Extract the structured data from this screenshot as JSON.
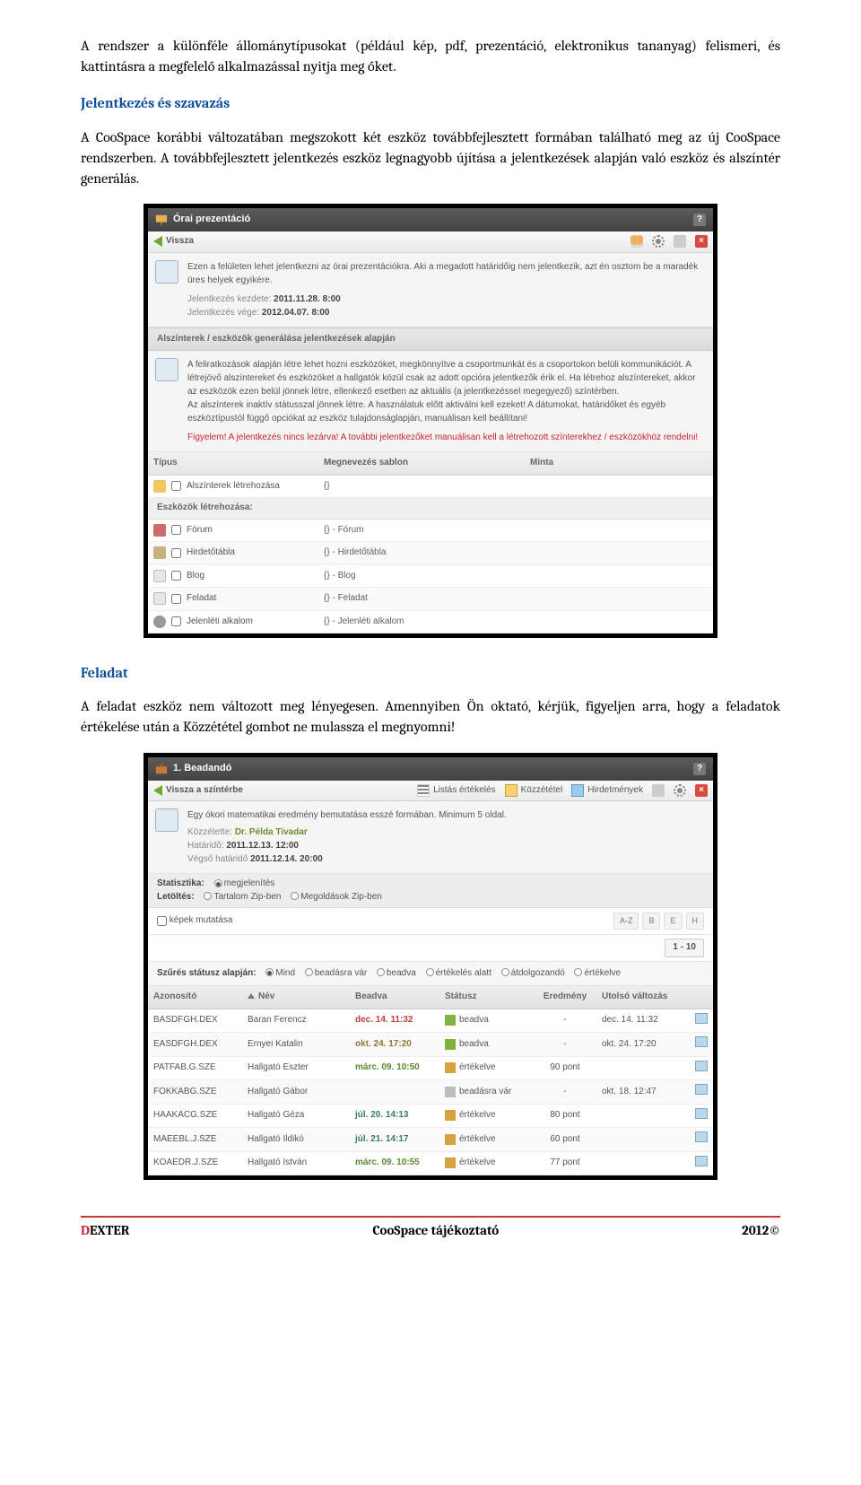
{
  "intro_p": "A rendszer a különféle állománytípusokat (például kép, pdf, prezentáció, elektronikus tananyag) felismeri, és kattintásra a megfelelő alkalmazással nyitja meg őket.",
  "heading_signup": "Jelentkezés és szavazás",
  "signup_p": "A CooSpace korábbi változatában megszokott két eszköz továbbfejlesztett formában található meg az új CooSpace rendszerben. A továbbfejlesztett jelentkezés eszköz legnagyobb újítása a jelentkezések alapján való eszköz és alszíntér generálás.",
  "heading_task": "Feladat",
  "task_p": "A feladat eszköz nem változott meg lényegesen. Amennyiben Ön oktató, kérjük, figyeljen arra, hogy a feladatok értékelése után a Közzététel gombot ne mulassza el megnyomni!",
  "sc1": {
    "title": "Órai prezentáció",
    "back": "Vissza",
    "info_text": "Ezen a felületen lehet jelentkezni az órai prezentációkra. Aki a megadott határidőig nem jelentkezik, azt én osztom be a maradék üres helyek egyikére.",
    "start_label": "Jelentkezés kezdete:",
    "start_value": "2011.11.28. 8:00",
    "end_label": "Jelentkezés vége:",
    "end_value": "2012.04.07. 8:00",
    "gen_title": "Alszínterek / eszközök generálása jelentkezések alapján",
    "gen_info": "A feliratkozások alapján létre lehet hozni eszközöket, megkönnyítve a csoportmunkát és a csoportokon belüli kommunikációt. A létrejövő alszíntereket és eszközöket a hallgatók közül csak az adott opcióra jelentkezők érik el. Ha létrehoz alszíntereket, akkor az eszközök ezen belül jönnek létre, ellenkező esetben az aktuális (a jelentkezéssel megegyező) színtérben.\nAz alszínterek inaktív státusszal jönnek létre. A használatuk előtt aktiválni kell ezeket! A dátumokat, határidőket és egyéb eszköztípustól függő opciókat az eszköz tulajdonságlapján, manuálisan kell beállítani!",
    "gen_warn": "Figyelem! A jelentkezés nincs lezárva! A további jelentkezőket manuálisan kell a létrehozott színterekhez / eszközökhöz rendelni!",
    "col_type": "Típus",
    "col_tpl": "Megnevezés sablon",
    "col_sample": "Minta",
    "row_sub": "Alszínterek létrehozása",
    "tpl_brace": "{}",
    "sub_tools": "Eszközök létrehozása:",
    "rows": [
      {
        "label": "Fórum",
        "tpl": "{} - Fórum"
      },
      {
        "label": "Hirdetőtábla",
        "tpl": "{} - Hirdetőtábla"
      },
      {
        "label": "Blog",
        "tpl": "{} - Blog"
      },
      {
        "label": "Feladat",
        "tpl": "{} - Feladat"
      },
      {
        "label": "Jelenléti alkalom",
        "tpl": "{} - Jelenléti alkalom"
      }
    ]
  },
  "sc2": {
    "title": "1. Beadandó",
    "back": "Vissza a színtérbe",
    "tb_list": "Listás értékelés",
    "tb_pub": "Közzététel",
    "tb_ann": "Hirdetmények",
    "desc": "Egy ókori matematikai eredmény bemutatása esszé formában. Minimum 5 oldal.",
    "by_label": "Közzétette:",
    "by_name": "Dr. Példa Tivadar",
    "dl1_label": "Határidő:",
    "dl1_value": "2011.12.13. 12:00",
    "dl2_label": "Végső határidő",
    "dl2_value": "2011.12.14. 20:00",
    "stat_label": "Statisztika:",
    "stat_show": "megjelenítés",
    "down_label": "Letöltés:",
    "down_o1": "Tartalom Zip-ben",
    "down_o2": "Megoldások Zip-ben",
    "show_images": "képek mutatása",
    "az": "A-Z",
    "b": "B",
    "e": "E",
    "h": "H",
    "pager": "1 - 10",
    "filter_label": "Szűrés státusz alapján:",
    "filter_opts": [
      "Mind",
      "beadásra vár",
      "beadva",
      "értékelés alatt",
      "átdolgozandó",
      "értékelve"
    ],
    "cols": {
      "id": "Azonosító",
      "name": "Név",
      "sub": "Beadva",
      "status": "Státusz",
      "res": "Eredmény",
      "mod": "Utolsó változás"
    },
    "rows": [
      {
        "id": "BASDFGH.DEX",
        "name": "Baran Ferencz",
        "sub": "dec. 14. 11:32",
        "subcls": "date-red",
        "st": "beadva",
        "stcls": "st-green",
        "res": "-",
        "mod": "dec. 14. 11:32"
      },
      {
        "id": "EASDFGH.DEX",
        "name": "Ernyei Katalin",
        "sub": "okt. 24. 17:20",
        "subcls": "date-olive",
        "st": "beadva",
        "stcls": "st-green",
        "res": "-",
        "mod": "okt. 24. 17:20"
      },
      {
        "id": "PATFAB.G.SZE",
        "name": "Hallgató Eszter",
        "sub": "márc. 09. 10:50",
        "subcls": "date-green",
        "st": "értékelve",
        "stcls": "st-amber",
        "res": "90 pont",
        "mod": ""
      },
      {
        "id": "FOKKABG.SZE",
        "name": "Hallgató Gábor",
        "sub": "",
        "subcls": "",
        "st": "beadásra vár",
        "stcls": "st-gray",
        "res": "-",
        "mod": "okt. 18. 12:47"
      },
      {
        "id": "HAAKACG.SZE",
        "name": "Hallgató Géza",
        "sub": "júl. 20. 14:13",
        "subcls": "date-teal",
        "st": "értékelve",
        "stcls": "st-amber",
        "res": "80 pont",
        "mod": ""
      },
      {
        "id": "MAEEBL.J.SZE",
        "name": "Hallgató Ildikó",
        "sub": "júl. 21. 14:17",
        "subcls": "date-teal",
        "st": "értékelve",
        "stcls": "st-amber",
        "res": "60 pont",
        "mod": ""
      },
      {
        "id": "KOAEDR.J.SZE",
        "name": "Hallgató István",
        "sub": "márc. 09. 10:55",
        "subcls": "date-green",
        "st": "értékelve",
        "stcls": "st-amber",
        "res": "77 pont",
        "mod": ""
      }
    ]
  },
  "footer": {
    "brand_rest": "EXTER",
    "center": "CooSpace tájékoztató",
    "year": "2012©"
  }
}
